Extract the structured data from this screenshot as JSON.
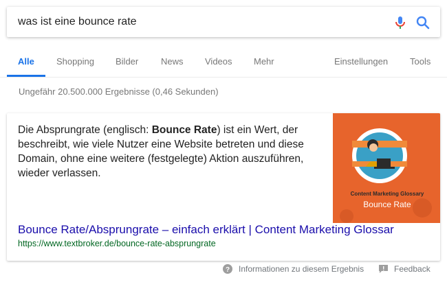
{
  "search": {
    "query": "was ist eine bounce rate"
  },
  "tabs": [
    {
      "label": "Alle",
      "active": true
    },
    {
      "label": "Shopping"
    },
    {
      "label": "Bilder"
    },
    {
      "label": "News"
    },
    {
      "label": "Videos"
    },
    {
      "label": "Mehr"
    },
    {
      "label": "Einstellungen"
    },
    {
      "label": "Tools"
    }
  ],
  "stats": "Ungefähr 20.500.000 Ergebnisse (0,46 Sekunden)",
  "snippet": {
    "text_before": "Die Absprungrate (englisch: ",
    "text_bold": "Bounce Rate",
    "text_after": ") ist ein Wert, der beschreibt, wie viele Nutzer eine Website betreten und diese Domain, ohne eine weitere (festgelegte) Aktion auszuführen, wieder verlassen."
  },
  "thumbnail": {
    "caption_small": "Content Marketing Glossary",
    "caption_large": "Bounce Rate"
  },
  "result": {
    "title": "Bounce Rate/Absprungrate – einfach erklärt | Content Marketing Glossar",
    "url": "https://www.textbroker.de/bounce-rate-absprungrate"
  },
  "footer": {
    "info": "Informationen zu diesem Ergebnis",
    "feedback": "Feedback"
  },
  "colors": {
    "accent": "#1a73e8",
    "link": "#1a0dab",
    "url": "#006621",
    "thumb_bg": "#e7642c"
  }
}
